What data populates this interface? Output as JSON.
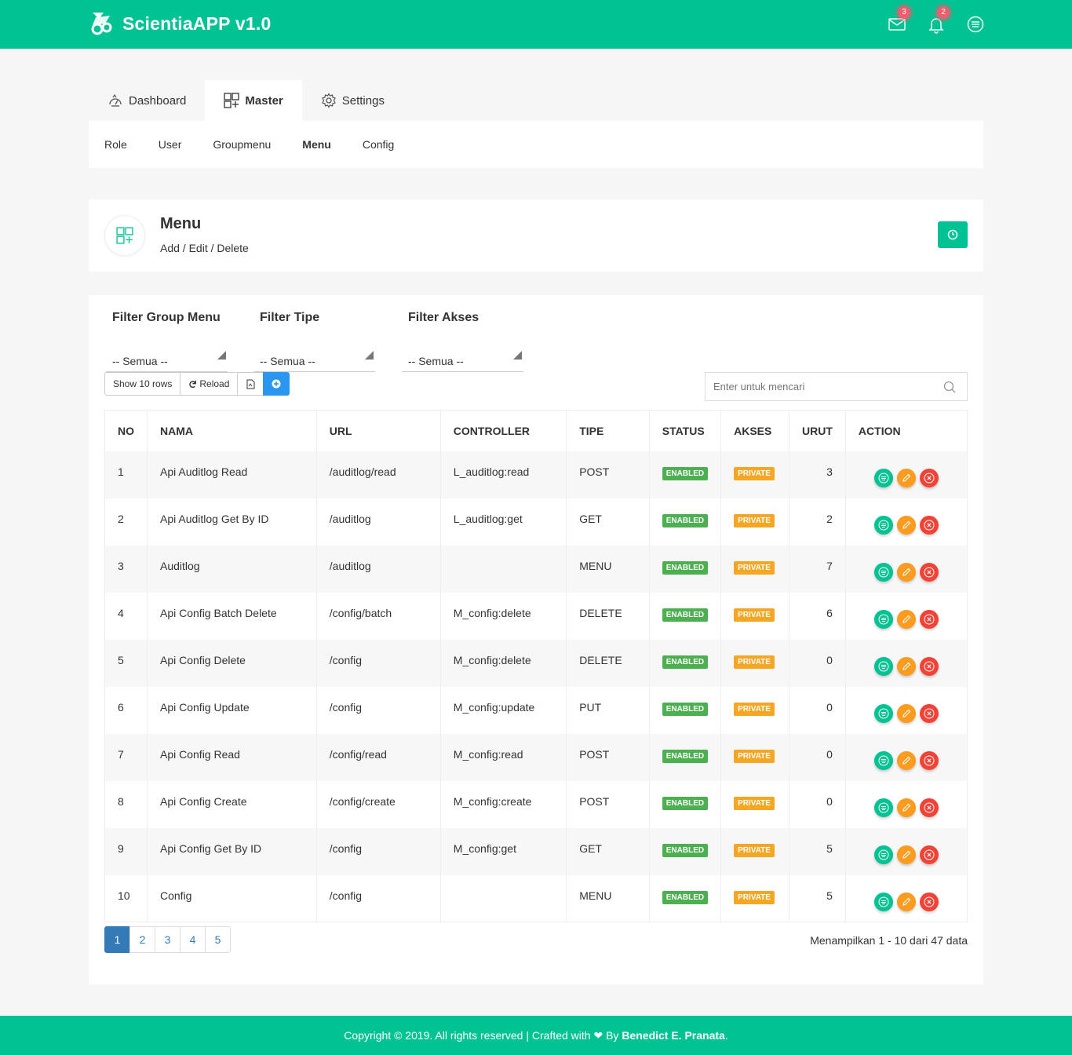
{
  "app": {
    "title": "ScientiaAPP v1.0"
  },
  "topbar": {
    "mail_count": "3",
    "notif_count": "2"
  },
  "tabs": [
    {
      "label": "Dashboard"
    },
    {
      "label": "Master"
    },
    {
      "label": "Settings"
    }
  ],
  "subnav": [
    "Role",
    "User",
    "Groupmenu",
    "Menu",
    "Config"
  ],
  "header": {
    "title": "Menu",
    "subtitle": "Add / Edit / Delete"
  },
  "filters": [
    {
      "label": "Filter Group Menu",
      "value": "-- Semua --"
    },
    {
      "label": "Filter Tipe",
      "value": "-- Semua --"
    },
    {
      "label": "Filter Akses",
      "value": "-- Semua --"
    }
  ],
  "toolbar": {
    "rows": "Show 10 rows",
    "reload": "Reload"
  },
  "search": {
    "placeholder": "Enter untuk mencari"
  },
  "table": {
    "columns": [
      "NO",
      "NAMA",
      "URL",
      "CONTROLLER",
      "TIPE",
      "STATUS",
      "AKSES",
      "URUT",
      "ACTION"
    ],
    "rows": [
      {
        "no": "1",
        "nama": "Api Auditlog Read",
        "url": "/auditlog/read",
        "controller": "L_auditlog:read",
        "tipe": "POST",
        "status": "ENABLED",
        "akses": "PRIVATE",
        "urut": "3"
      },
      {
        "no": "2",
        "nama": "Api Auditlog Get By ID",
        "url": "/auditlog",
        "controller": "L_auditlog:get",
        "tipe": "GET",
        "status": "ENABLED",
        "akses": "PRIVATE",
        "urut": "2"
      },
      {
        "no": "3",
        "nama": "Auditlog",
        "url": "/auditlog",
        "controller": "",
        "tipe": "MENU",
        "status": "ENABLED",
        "akses": "PRIVATE",
        "urut": "7"
      },
      {
        "no": "4",
        "nama": "Api Config Batch Delete",
        "url": "/config/batch",
        "controller": "M_config:delete",
        "tipe": "DELETE",
        "status": "ENABLED",
        "akses": "PRIVATE",
        "urut": "6"
      },
      {
        "no": "5",
        "nama": "Api Config Delete",
        "url": "/config",
        "controller": "M_config:delete",
        "tipe": "DELETE",
        "status": "ENABLED",
        "akses": "PRIVATE",
        "urut": "0"
      },
      {
        "no": "6",
        "nama": "Api Config Update",
        "url": "/config",
        "controller": "M_config:update",
        "tipe": "PUT",
        "status": "ENABLED",
        "akses": "PRIVATE",
        "urut": "0"
      },
      {
        "no": "7",
        "nama": "Api Config Read",
        "url": "/config/read",
        "controller": "M_config:read",
        "tipe": "POST",
        "status": "ENABLED",
        "akses": "PRIVATE",
        "urut": "0"
      },
      {
        "no": "8",
        "nama": "Api Config Create",
        "url": "/config/create",
        "controller": "M_config:create",
        "tipe": "POST",
        "status": "ENABLED",
        "akses": "PRIVATE",
        "urut": "0"
      },
      {
        "no": "9",
        "nama": "Api Config Get By ID",
        "url": "/config",
        "controller": "M_config:get",
        "tipe": "GET",
        "status": "ENABLED",
        "akses": "PRIVATE",
        "urut": "5"
      },
      {
        "no": "10",
        "nama": "Config",
        "url": "/config",
        "controller": "",
        "tipe": "MENU",
        "status": "ENABLED",
        "akses": "PRIVATE",
        "urut": "5"
      }
    ]
  },
  "pagination": {
    "pages": [
      "1",
      "2",
      "3",
      "4",
      "5"
    ],
    "current": "1",
    "info": "Menampilkan 1 - 10 dari 47 data"
  },
  "footer": {
    "text": "Copyright © 2019. All rights reserved | Crafted with ❤ By ",
    "author": "Benedict E. Pranata",
    "end": "."
  },
  "colors": {
    "primary": "#00c292",
    "enabled": "#4caf50",
    "private": "#f5a623",
    "danger": "#f44336",
    "warning": "#fb9b1f",
    "link": "#337ab7"
  }
}
